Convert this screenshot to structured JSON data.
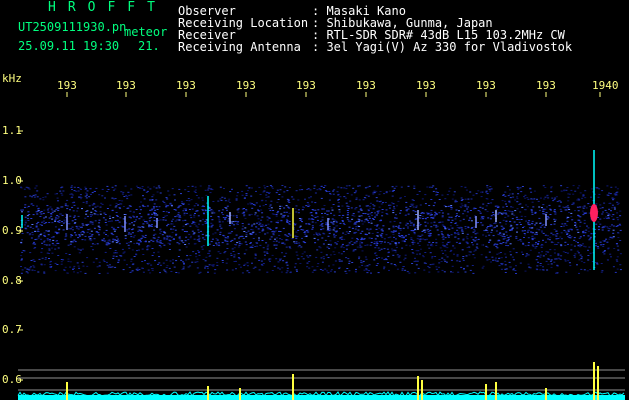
{
  "header": {
    "logo": "HROFFT",
    "filename": "UT2509111930.pn",
    "tag": "meteor",
    "datetime": "25.09.11 19:30",
    "count": "21.",
    "rows": [
      {
        "label": "Observer",
        "value": ": Masaki Kano"
      },
      {
        "label": "Receiving Location",
        "value": ": Shibukawa, Gunma, Japan"
      },
      {
        "label": "Receiver",
        "value": ": RTL-SDR SDR# 43dB L15 103.2MHz CW"
      },
      {
        "label": "Receiving Antenna",
        "value": ": 3el Yagi(V) Az 330 for Vladivostok"
      }
    ]
  },
  "axis": {
    "unit": "kHz",
    "y_ticks": [
      "1.1",
      "1.0",
      "0.9",
      "0.8",
      "0.7",
      "0.6"
    ],
    "x_ticks": [
      "193",
      "193",
      "193",
      "193",
      "193",
      "193",
      "193",
      "193",
      "193",
      "1940"
    ]
  },
  "colors": {
    "text_header_left": "#00ff7f",
    "text_header_right": "#ffffff",
    "axis_labels": "#ffff80",
    "noise_band": "#1a2aa0",
    "trace_cyan": "#00ffff",
    "spike_yellow": "#ffff40",
    "hot_magenta": "#ff2060"
  }
}
